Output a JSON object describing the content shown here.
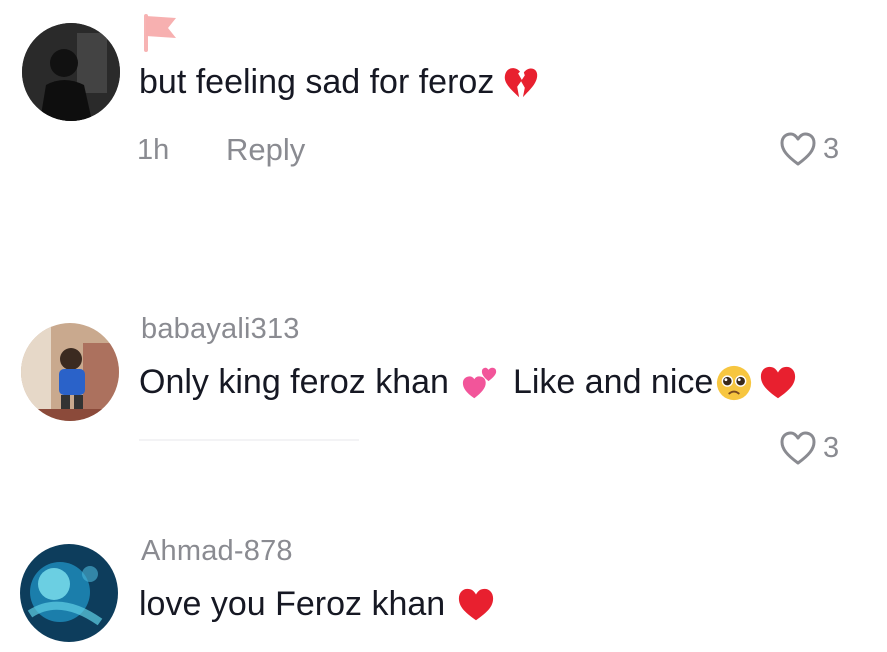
{
  "comments": [
    {
      "username": "",
      "text": "but feeling sad for feroz",
      "emojis": [
        "broken-heart-emoji"
      ],
      "time": "1h",
      "reply_label": "Reply",
      "likes": "3"
    },
    {
      "username": "babayali313",
      "text": "Only king feroz khan",
      "text_after": "Like and nice",
      "emojis": [
        "two-hearts-emoji",
        "pleading-face-emoji",
        "red-heart-emoji"
      ],
      "likes": "3"
    },
    {
      "username": "Ahmad-878",
      "text": "love you Feroz khan",
      "emojis": [
        "red-heart-emoji"
      ]
    }
  ],
  "colors": {
    "text": "#161823",
    "muted": "#8a8b91",
    "heart_red": "#e8202f",
    "pink_hearts": "#f2559a",
    "flag": "#f28c8c"
  }
}
